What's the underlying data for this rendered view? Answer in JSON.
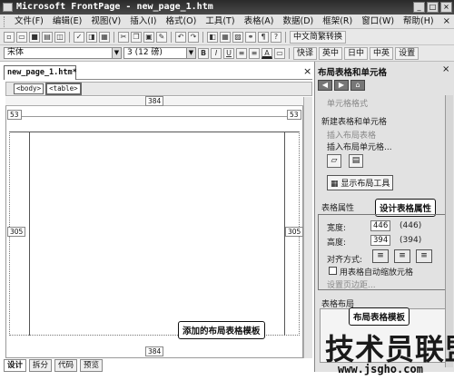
{
  "window": {
    "title": "Microsoft FrontPage - new_page_1.htm",
    "buttons": [
      "_",
      "□",
      "×"
    ]
  },
  "menu": {
    "items": [
      "文件(F)",
      "编辑(E)",
      "视图(V)",
      "插入(I)",
      "格式(O)",
      "工具(T)",
      "表格(A)",
      "数据(D)",
      "框架(R)",
      "窗口(W)",
      "帮助(H)"
    ],
    "close": "×"
  },
  "toolbar1": {
    "translate_label": "中文简繁转换"
  },
  "toolbar2": {
    "font_name": "宋体",
    "font_size": "3 (12 磅)",
    "btn_labels": [
      "快译",
      "英中",
      "日中",
      "中英",
      "设置"
    ]
  },
  "document": {
    "tab_label": "new_page_1.htm*",
    "close": "×",
    "tags": [
      "<body>",
      "<table>"
    ],
    "width_top": "384",
    "width_bottom": "384",
    "left_top": "53",
    "right_top": "53",
    "left_mid": "305",
    "right_mid": "305",
    "callout_template": "添加的布局表格模板"
  },
  "view_tabs": [
    "设计",
    "拆分",
    "代码",
    "预览"
  ],
  "panel": {
    "title": "布局表格和单元格",
    "close": "×",
    "partial_top": "单元格格式",
    "new_section": "新建表格和单元格",
    "insert_table": "插入布局表格",
    "insert_cell": "插入布局单元格...",
    "show_tool": "显示布局工具",
    "props_label": "表格属性",
    "callout_props": "设计表格属性",
    "width_label": "宽度:",
    "width_value": "446",
    "width_paren": "(446)",
    "height_label": "高度:",
    "height_value": "394",
    "height_paren": "(394)",
    "align_label": "对齐方式:",
    "auto_scale": "用表格自动缩放元格",
    "page_margin": "设置页边距...",
    "template_label": "表格布局",
    "callout_template": "布局表格模板"
  },
  "watermark": {
    "text": "技术员联盟",
    "url": "www.jsgho.com"
  }
}
